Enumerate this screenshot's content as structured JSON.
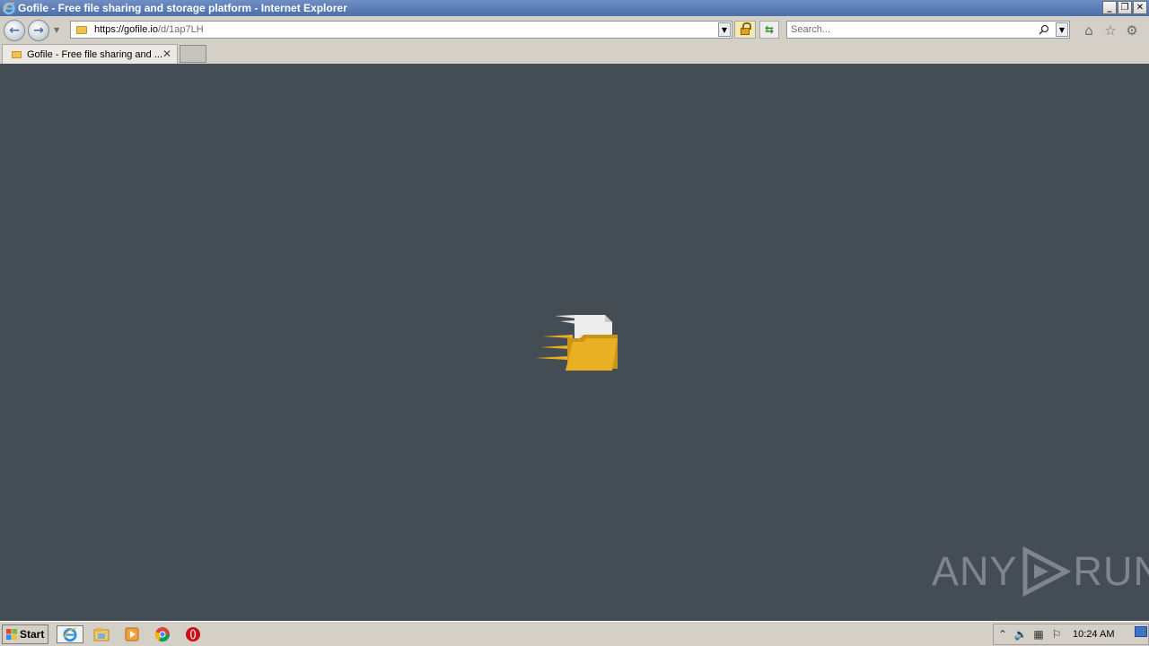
{
  "window": {
    "title": "Gofile - Free file sharing and storage platform - Internet Explorer",
    "controls": [
      "minimize",
      "restore",
      "close"
    ]
  },
  "navbar": {
    "url_host": "https://gofile.io",
    "url_path": "/d/1ap7LH",
    "search_placeholder": "Search...",
    "tool_icons": [
      "home-icon",
      "favorites-star-icon",
      "settings-gear-icon"
    ]
  },
  "tabs": [
    {
      "label": "Gofile - Free file sharing and ...",
      "active": true
    }
  ],
  "content": {
    "background": "#444c54",
    "loader_icon": "flying-folder-icon",
    "loader_color": "#e9b024",
    "watermark": {
      "left": "ANY",
      "right": "RUN"
    }
  },
  "taskbar": {
    "start_label": "Start",
    "apps": [
      "internet-explorer-icon",
      "file-explorer-icon",
      "media-player-icon",
      "chrome-icon",
      "opera-icon"
    ],
    "tray_icons": [
      "show-hidden-icons-icon",
      "volume-icon",
      "network-icon",
      "action-center-flag-icon"
    ],
    "clock": "10:24 AM"
  }
}
